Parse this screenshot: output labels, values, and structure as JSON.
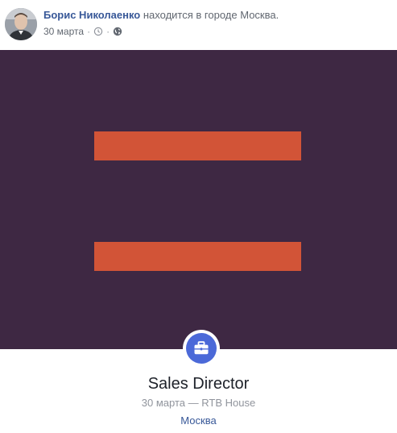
{
  "post": {
    "author_name": "Борис Николаенко",
    "action_text": "находится в городе",
    "place": "Москва",
    "place_suffix": ".",
    "date": "30 марта",
    "separator": "·",
    "icons": {
      "avatar": "user-avatar-photo",
      "time": "clock-icon",
      "privacy": "globe-icon"
    }
  },
  "hero": {
    "background_color": "#3e2843",
    "bar_color": "#d25437"
  },
  "life_event": {
    "icon": "briefcase-icon",
    "icon_color": "#4b69d8",
    "title": "Sales Director",
    "subtitle": "30 марта — RTB House",
    "place": "Москва"
  }
}
